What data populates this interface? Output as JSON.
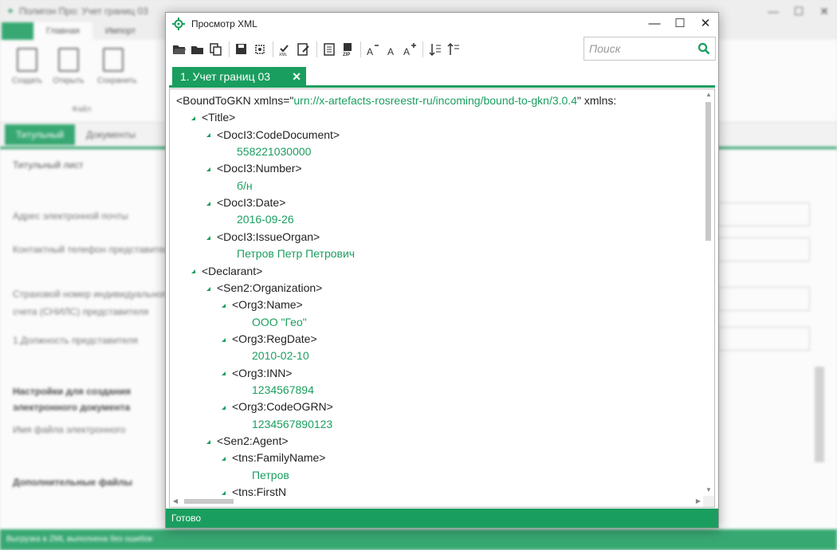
{
  "background_app": {
    "title": "Полигон Про: Учет границ 03",
    "tabs": [
      "Главная",
      "Импорт"
    ],
    "ribbon_buttons": [
      "Создать",
      "Открыть",
      "Сохранить"
    ],
    "ribbon_group": "Файл",
    "doc_tabs": [
      "Титульный",
      "Документы"
    ],
    "section_title": "Титульный лист",
    "rows": [
      "Адрес электронной почты",
      "Контактный телефон представителя",
      "Страховой номер индивидуального",
      "счета (СНИЛС) представителя",
      "1.Должность представителя",
      "Настройки для создания",
      "электронного документа",
      "Имя файла электронного",
      "Дополнительные файлы"
    ],
    "status": "Выгрузка в ZML выполнена без ошибок"
  },
  "dialog": {
    "title": "Просмотр XML",
    "controls": {
      "minimize": "—",
      "maximize": "☐",
      "close": "✕"
    },
    "search_placeholder": "Поиск",
    "tab_label": "1. Учет границ 03",
    "tab_close": "✕",
    "status": "Готово"
  },
  "xml_lines": [
    {
      "depth": 0,
      "tag": "<BoundToGKN xmlns=\"",
      "attr": "urn://x-artefacts-rosreestr-ru/incoming/bound-to-gkn/3.0.4",
      "tail": "\" xmlns:",
      "arrow": false
    },
    {
      "depth": 1,
      "tag": "<Title>",
      "arrow": true
    },
    {
      "depth": 2,
      "tag": "<DocI3:CodeDocument>",
      "arrow": true
    },
    {
      "depth": 3,
      "value": "558221030000"
    },
    {
      "depth": 2,
      "tag": "<DocI3:Number>",
      "arrow": true
    },
    {
      "depth": 3,
      "value": "б/н"
    },
    {
      "depth": 2,
      "tag": "<DocI3:Date>",
      "arrow": true
    },
    {
      "depth": 3,
      "value": "2016-09-26"
    },
    {
      "depth": 2,
      "tag": "<DocI3:IssueOrgan>",
      "arrow": true
    },
    {
      "depth": 3,
      "value": "Петров Петр Петрович"
    },
    {
      "depth": 1,
      "tag": "<Declarant>",
      "arrow": true
    },
    {
      "depth": 2,
      "tag": "<Sen2:Organization>",
      "arrow": true
    },
    {
      "depth": 3,
      "tag": "<Org3:Name>",
      "arrow": true
    },
    {
      "depth": 4,
      "value": "ООО \"Гео\""
    },
    {
      "depth": 3,
      "tag": "<Org3:RegDate>",
      "arrow": true
    },
    {
      "depth": 4,
      "value": "2010-02-10"
    },
    {
      "depth": 3,
      "tag": "<Org3:INN>",
      "arrow": true
    },
    {
      "depth": 4,
      "value": "1234567894"
    },
    {
      "depth": 3,
      "tag": "<Org3:CodeOGRN>",
      "arrow": true
    },
    {
      "depth": 4,
      "value": "1234567890123"
    },
    {
      "depth": 2,
      "tag": "<Sen2:Agent>",
      "arrow": true
    },
    {
      "depth": 3,
      "tag": "<tns:FamilyName>",
      "arrow": true
    },
    {
      "depth": 4,
      "value": "Петров"
    },
    {
      "depth": 3,
      "tag": "<tns:FirstN",
      "arrow": true
    }
  ],
  "colors": {
    "accent": "#1a9e5f"
  }
}
